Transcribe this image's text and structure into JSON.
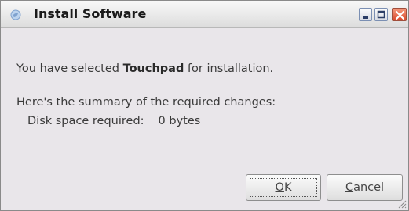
{
  "window": {
    "title": "Install Software",
    "app_icon": "globe-icon",
    "controls": [
      "minimize-icon",
      "maximize-icon",
      "close-icon"
    ]
  },
  "message": {
    "prefix": "You have selected ",
    "package": "Touchpad",
    "suffix": " for installation."
  },
  "summary": {
    "heading": "Here's the summary of the required changes:",
    "disk_label": "Disk space required:",
    "disk_value": "0 bytes"
  },
  "buttons": {
    "ok": {
      "mnemonic": "O",
      "rest": "K"
    },
    "cancel": {
      "mnemonic": "C",
      "rest": "ancel"
    }
  },
  "colors": {
    "dialog_background": "#e9e6ea",
    "close_button": "#d9472a"
  }
}
